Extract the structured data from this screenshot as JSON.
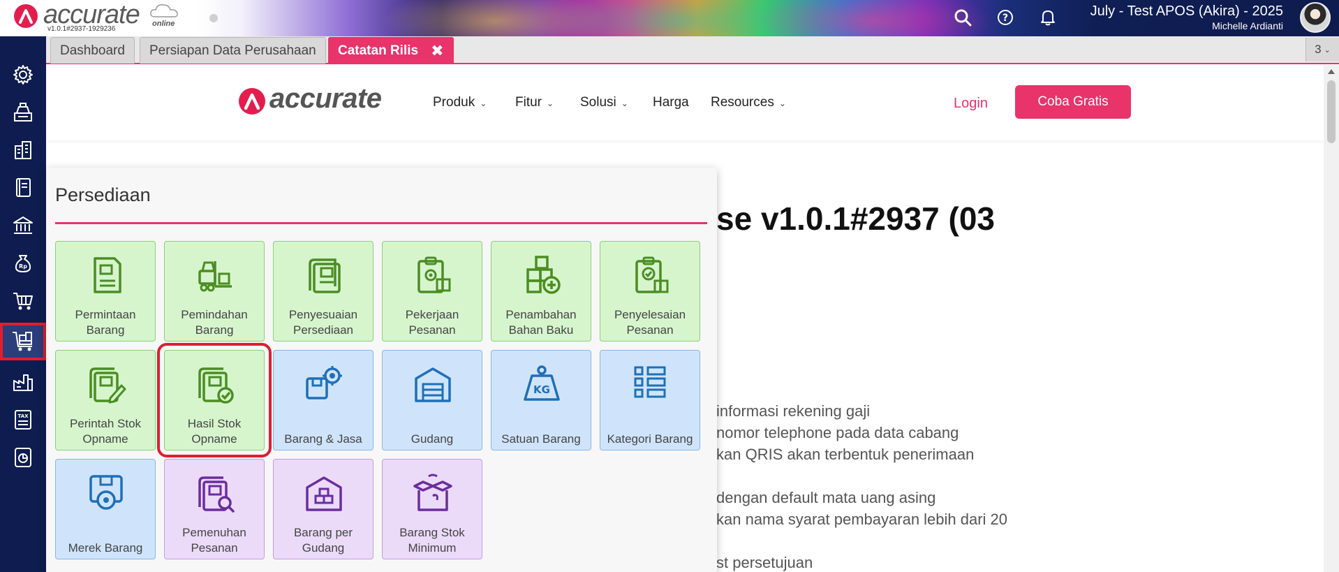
{
  "app": {
    "brand": "accurate",
    "brand_sub": "online",
    "version": "v1.0.1#2937-1929236",
    "company_name": "July - Test APOS (Akira) - 2025",
    "user_name": "Michelle Ardianti",
    "top_icons": [
      "search-icon",
      "help-icon",
      "bell-icon"
    ]
  },
  "leftnav": {
    "items": [
      {
        "icon": "gear-icon"
      },
      {
        "icon": "cash-register-icon"
      },
      {
        "icon": "building-icon"
      },
      {
        "icon": "book-icon"
      },
      {
        "icon": "bank-icon"
      },
      {
        "icon": "money-bag-icon"
      },
      {
        "icon": "cart-icon"
      },
      {
        "icon": "inventory-cart-icon",
        "active": true
      },
      {
        "icon": "factory-icon"
      },
      {
        "icon": "tax-icon"
      },
      {
        "icon": "report-icon"
      }
    ]
  },
  "tabs": {
    "items": [
      {
        "label": "Dashboard"
      },
      {
        "label": "Persiapan Data Perusahaan"
      },
      {
        "label": "Catatan Rilis",
        "active": true,
        "close": "✖"
      }
    ],
    "count": "3"
  },
  "site": {
    "logo": "accurate",
    "nav": [
      {
        "label": "Produk",
        "has_dropdown": true
      },
      {
        "label": "Fitur",
        "has_dropdown": true
      },
      {
        "label": "Solusi",
        "has_dropdown": true
      },
      {
        "label": "Harga",
        "has_dropdown": false
      },
      {
        "label": "Resources",
        "has_dropdown": true
      }
    ],
    "login": "Login",
    "cta": "Coba Gratis",
    "release_title": "se v1.0.1#2937 (03",
    "release_lines": [
      "informasi rekening gaji",
      "nomor telephone pada data cabang",
      "kan QRIS akan terbentuk penerimaan",
      "dengan default mata uang asing",
      "kan nama syarat pembayaran lebih dari 20",
      "st persetujuan"
    ]
  },
  "popup": {
    "title": "Persediaan",
    "tiles": [
      {
        "label": "Permintaan Barang",
        "color": "green",
        "icon": "request-document-icon"
      },
      {
        "label": "Pemindahan Barang",
        "color": "green",
        "icon": "forklift-icon"
      },
      {
        "label": "Penyesuaian Persediaan",
        "color": "green",
        "icon": "adjustment-document-icon"
      },
      {
        "label": "Pekerjaan Pesanan",
        "color": "green",
        "icon": "clipboard-gear-icon"
      },
      {
        "label": "Penambahan Bahan Baku",
        "color": "green",
        "icon": "boxes-plus-icon"
      },
      {
        "label": "Penyelesaian Pesanan",
        "color": "green",
        "icon": "clipboard-check-icon"
      },
      {
        "label": "Perintah Stok Opname",
        "color": "green",
        "icon": "document-pencil-icon"
      },
      {
        "label": "Hasil Stok Opname",
        "color": "green",
        "icon": "document-check-icon",
        "highlighted": true
      },
      {
        "label": "Barang & Jasa",
        "color": "blue",
        "icon": "box-gear-icon"
      },
      {
        "label": "Gudang",
        "color": "blue",
        "icon": "warehouse-icon"
      },
      {
        "label": "Satuan Barang",
        "color": "blue",
        "icon": "weight-kg-icon"
      },
      {
        "label": "Kategori Barang",
        "color": "blue",
        "icon": "category-list-icon"
      },
      {
        "label": "Merek Barang",
        "color": "blue",
        "icon": "brand-badge-icon"
      },
      {
        "label": "Pemenuhan Pesanan",
        "color": "purple",
        "icon": "document-search-icon"
      },
      {
        "label": "Barang per Gudang",
        "color": "purple",
        "icon": "warehouse-boxes-icon"
      },
      {
        "label": "Barang Stok Minimum",
        "color": "purple",
        "icon": "open-box-icon"
      }
    ]
  },
  "colors": {
    "accent": "#e8336b",
    "nav_bg": "#0e1c4f",
    "tile_green": "#d6f5cd",
    "tile_blue": "#cfe4fb",
    "tile_purple": "#ebdbf9"
  }
}
